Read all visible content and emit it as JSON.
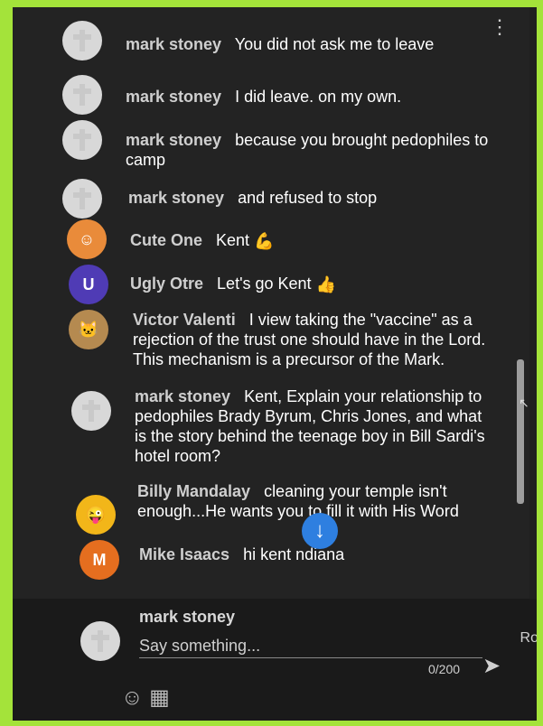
{
  "messages": [
    {
      "author": "mark stoney",
      "text": "You did not ask me to leave",
      "avatar": "cross",
      "color": "#d8d8d8"
    },
    {
      "author": "mark stoney",
      "text": "I did leave. on my own.",
      "avatar": "cross",
      "color": "#d8d8d8"
    },
    {
      "author": "mark stoney",
      "text": "because you brought pedophiles to camp",
      "avatar": "cross",
      "color": "#d8d8d8"
    },
    {
      "author": "mark stoney",
      "text": "and refused to stop",
      "avatar": "cross",
      "color": "#d8d8d8"
    },
    {
      "author": "Cute One",
      "text": "Kent",
      "emoji": "💪",
      "avatar": "cute",
      "color": "#e98b3a"
    },
    {
      "author": "Ugly Otre",
      "text": "Let's go Kent",
      "emoji": "👍",
      "avatar": "U",
      "color": "#4f3bb5"
    },
    {
      "author": "Victor Valenti",
      "text": "I view taking the \"vaccine\" as a rejection of the trust one should have in the Lord. This mechanism is a precursor of the Mark.",
      "avatar": "cat",
      "color": "#b58a50"
    },
    {
      "author": "mark stoney",
      "text": "Kent, Explain your relationship to pedophiles Brady Byrum, Chris Jones, and what is the story behind the teenage boy in Bill Sardi's hotel room?",
      "avatar": "cross",
      "color": "#d8d8d8"
    },
    {
      "author": "Billy Mandalay",
      "text": "cleaning your temple isn't enough...He wants you to fill it with His Word",
      "avatar": "face",
      "color": "#f2b619"
    },
    {
      "author": "Mike Isaacs",
      "text": "hi kent ndiana",
      "avatar": "M",
      "color": "#e56e1f"
    }
  ],
  "composer": {
    "name": "mark stoney",
    "placeholder": "Say something...",
    "counter": "0/200",
    "send_icon": "send-icon"
  },
  "ui": {
    "menu_icon": "more-vert-icon",
    "scroll_down_icon": "arrow-down-icon",
    "cut_label": "Ro"
  }
}
